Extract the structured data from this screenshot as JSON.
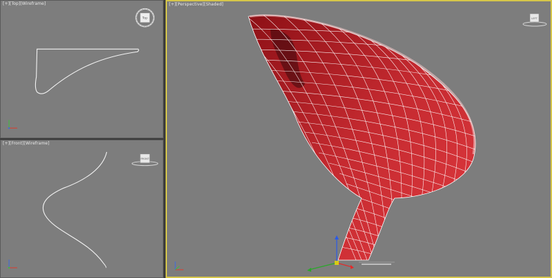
{
  "viewports": {
    "top": {
      "label_plus": "[+]",
      "label_view": "[Top]",
      "label_mode": "[Wireframe]",
      "viewcube_face": "Top"
    },
    "front": {
      "label_plus": "[+]",
      "label_view": "[Front]",
      "label_mode": "[Wireframe]",
      "viewcube_face": "FRONT"
    },
    "perspective": {
      "label_plus": "[+]",
      "label_view": "[Perspective]",
      "label_mode": "[Shaded]",
      "viewcube_face": "LEFT"
    }
  },
  "colors": {
    "viewport_bg": "#7d7d7d",
    "active_border": "#d6c64a",
    "mesh_red": "#b5242a",
    "wire": "#ffffff"
  }
}
